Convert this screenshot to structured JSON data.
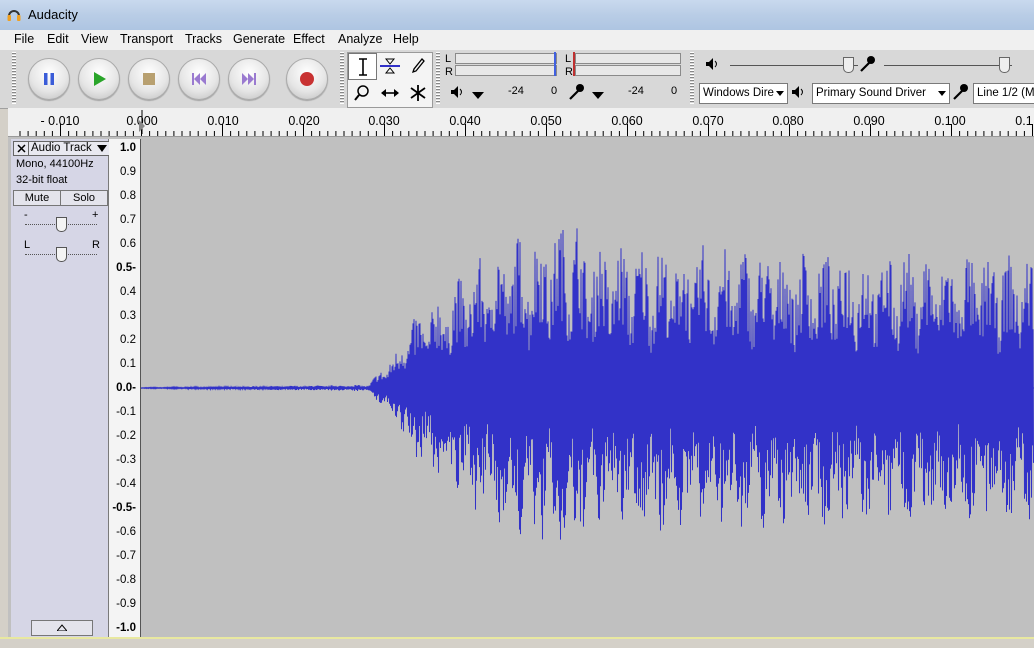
{
  "window": {
    "title": "Audacity"
  },
  "menu": [
    "File",
    "Edit",
    "View",
    "Transport",
    "Tracks",
    "Generate",
    "Effect",
    "Analyze",
    "Help"
  ],
  "menu_accels": [
    "F",
    "E",
    "V",
    "T",
    "T",
    "G",
    "c",
    "A",
    "H"
  ],
  "transport": {
    "buttons": [
      "pause-icon",
      "play-icon",
      "stop-icon",
      "skip-start-icon",
      "skip-end-icon",
      "record-icon"
    ]
  },
  "tools": [
    "selection-tool-icon",
    "envelope-tool-icon",
    "draw-tool-icon",
    "zoom-tool-icon",
    "timeshift-tool-icon",
    "multi-tool-icon"
  ],
  "meters": {
    "play_channels": [
      "L",
      "R"
    ],
    "rec_channels": [
      "L",
      "R"
    ],
    "play_scale": [
      "-24",
      "0"
    ],
    "rec_scale": [
      "-24",
      "0"
    ]
  },
  "devices": {
    "host": "Windows Dire",
    "output": "Primary Sound Driver",
    "input": "Line 1/2 (M-"
  },
  "timeline": {
    "labels": [
      "- 0.010",
      "0.000",
      "0.010",
      "0.020",
      "0.030",
      "0.040",
      "0.050",
      "0.060",
      "0.070",
      "0.080",
      "0.090",
      "0.100",
      "0.1"
    ]
  },
  "track": {
    "name": "Audio Track",
    "format": "Mono, 44100Hz",
    "bitdepth": "32-bit float",
    "mute_label": "Mute",
    "solo_label": "Solo",
    "gain_minus": "-",
    "gain_plus": "+",
    "pan_left": "L",
    "pan_right": "R"
  },
  "vruler": {
    "labels": [
      "1.0",
      "0.9",
      "0.8",
      "0.7",
      "0.6",
      "0.5-",
      "0.4",
      "0.3",
      "0.2",
      "0.1",
      "0.0-",
      "-0.1",
      "-0.2",
      "-0.3",
      "-0.4",
      "-0.5-",
      "-0.6",
      "-0.7",
      "-0.8",
      "-0.9",
      "-1.0"
    ]
  },
  "colors": {
    "waveform": "#3232c8",
    "wave_bg": "#c0c0c0",
    "selected_bar": "#e8e8a0"
  }
}
